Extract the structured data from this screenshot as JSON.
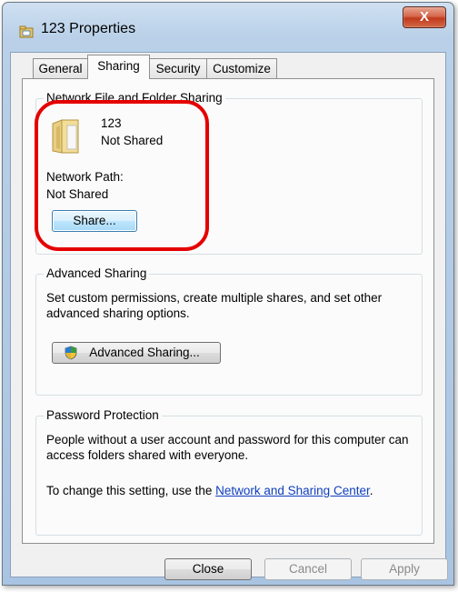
{
  "window": {
    "title": "123 Properties",
    "close_glyph": "X"
  },
  "tabs": [
    {
      "label": "General"
    },
    {
      "label": "Sharing"
    },
    {
      "label": "Security"
    },
    {
      "label": "Customize"
    }
  ],
  "active_tab": "Sharing",
  "network_sharing": {
    "group_label": "Network File and Folder Sharing",
    "folder_name": "123",
    "folder_status": "Not Shared",
    "network_path_label": "Network Path:",
    "network_path_value": "Not Shared",
    "share_button": "Share..."
  },
  "advanced_sharing": {
    "group_label": "Advanced Sharing",
    "description": "Set custom permissions, create multiple shares, and set other advanced sharing options.",
    "button": "Advanced Sharing..."
  },
  "password_protection": {
    "group_label": "Password Protection",
    "description": "People without a user account and password for this computer can access folders shared with everyone.",
    "change_prefix": "To change this setting, use the ",
    "link_text": "Network and Sharing Center",
    "change_suffix": "."
  },
  "footer": {
    "close_label": "Close",
    "cancel_label": "Cancel",
    "apply_label": "Apply"
  },
  "icons": {
    "title": "folder-properties-icon",
    "folder": "folder-icon",
    "shield": "uac-shield-icon"
  },
  "colors": {
    "highlight": "#e50000",
    "link": "#0f3fbd"
  }
}
